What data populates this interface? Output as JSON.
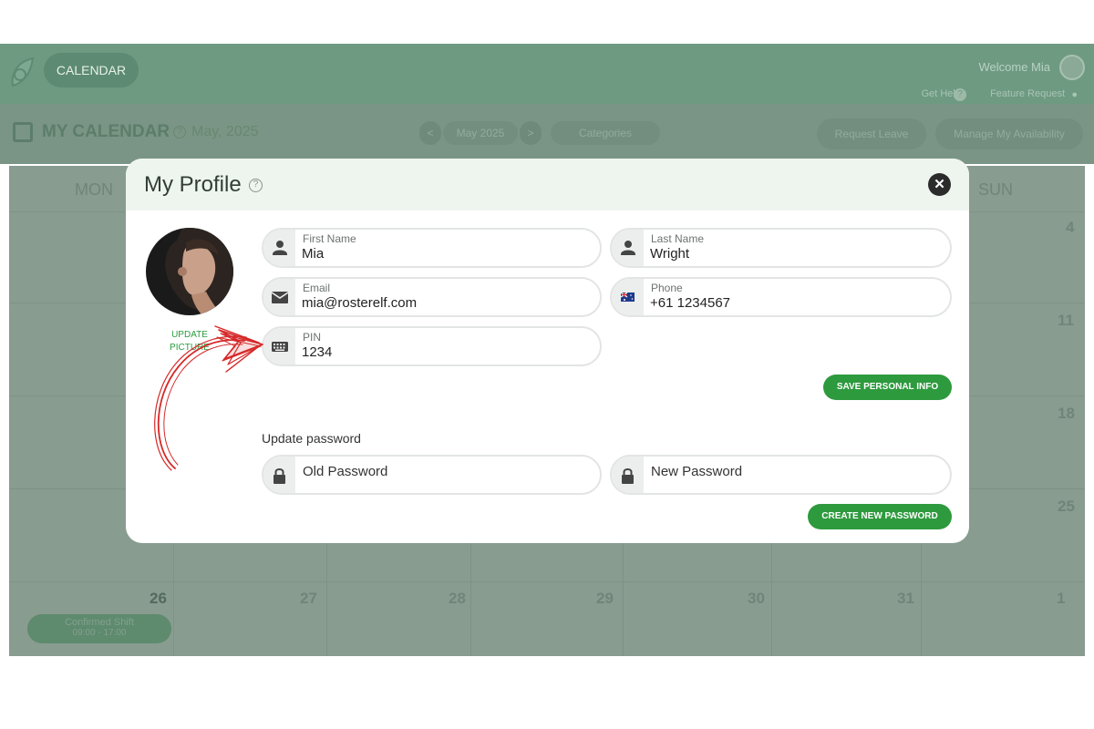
{
  "app": {
    "nav_item": "CALENDAR",
    "welcome": "Welcome Mia",
    "get_help": "Get Help",
    "feature_request": "Feature Request"
  },
  "calendar": {
    "title": "MY CALENDAR",
    "month_title": "May, 2025",
    "month_nav": "May 2025",
    "categories": "Categories",
    "request_leave": "Request Leave",
    "manage_availability": "Manage My Availability",
    "weekdays": [
      "MON",
      "SUN"
    ],
    "right_column_dates": [
      "4",
      "11",
      "18",
      "25"
    ],
    "last_row_dates": [
      "26",
      "27",
      "28",
      "29",
      "30",
      "31",
      "1"
    ],
    "shift": {
      "title": "Confirmed Shift",
      "time": "09:00 - 17:00"
    }
  },
  "modal": {
    "title": "My Profile",
    "update_picture": "UPDATE PICTURE",
    "fields": {
      "first_name": {
        "label": "First Name",
        "value": "Mia"
      },
      "last_name": {
        "label": "Last Name",
        "value": "Wright"
      },
      "email": {
        "label": "Email",
        "value": "mia@rosterelf.com"
      },
      "phone": {
        "label": "Phone",
        "value": "+61 1234567"
      },
      "pin": {
        "label": "PIN",
        "value": "1234"
      }
    },
    "save_button": "SAVE PERSONAL INFO",
    "password_section": "Update password",
    "old_password": "Old Password",
    "new_password": "New Password",
    "create_button": "CREATE NEW PASSWORD"
  },
  "colors": {
    "accent": "#2e9a3e",
    "annotation": "#d62828",
    "overlay": "#6e8c7a"
  }
}
